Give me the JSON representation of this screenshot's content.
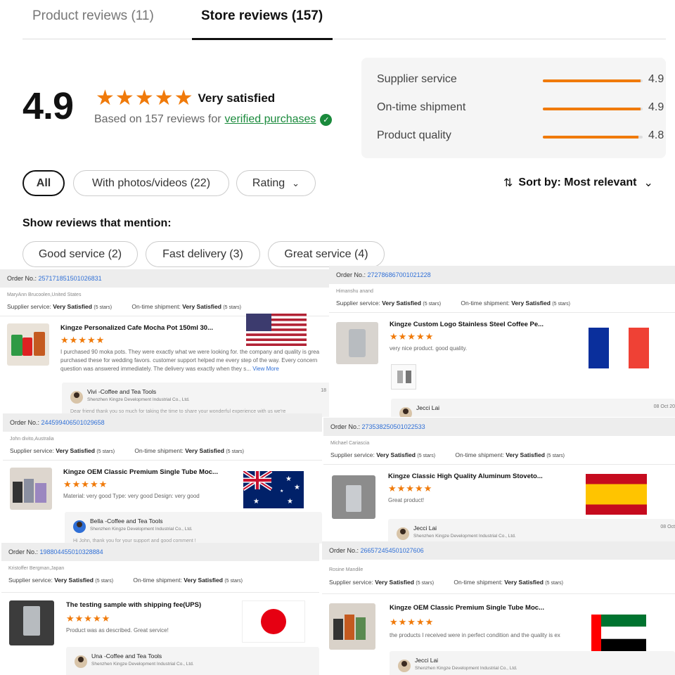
{
  "tabs": {
    "product": "Product reviews (11)",
    "store": "Store reviews (157)"
  },
  "summary": {
    "score": "4.9",
    "stars": "★★★★★",
    "label": "Very satisfied",
    "based_prefix": "Based on 157 reviews for",
    "verified_link": "verified purchases",
    "verified_icon": "check-badge-icon"
  },
  "ratings": [
    {
      "label": "Supplier service",
      "value": "4.9",
      "fill": 0.98
    },
    {
      "label": "On-time shipment",
      "value": "4.9",
      "fill": 0.98
    },
    {
      "label": "Product quality",
      "value": "4.8",
      "fill": 0.96
    }
  ],
  "filters": {
    "all": "All",
    "photos": "With photos/videos (22)",
    "rating": "Rating",
    "sort": "Sort by: Most relevant"
  },
  "mention": {
    "title": "Show reviews that mention:",
    "tags": [
      "Good service (2)",
      "Fast delivery (3)",
      "Great service (4)"
    ]
  },
  "order_prefix": "Order No.:",
  "supplier_service_label": "Supplier service:",
  "ontime_label": "On-time shipment:",
  "very_satisfied": "Very Satisfied",
  "five_stars": "(5 stars)",
  "mini_stars": "★★★★★",
  "company": "Shenzhen Kingze Development Industrial Co., Ltd.",
  "reviews": [
    {
      "order_no": "257171851501026831",
      "reviewer": "MaryAnn Brucoolen,United States",
      "title": "Kingze Personalized Cafe Mocha Pot 150ml 30...",
      "text1": "I purchased 90 moka pots. They were exactly what we were looking for. the company and quality is grea",
      "text2": "purchased these for wedding favors. customer support helped me every step of the way. Every concern",
      "text3": "question was answered immediately. The delivery was exactly when they s...",
      "view_more": "View More",
      "reply_name": "Vivi -Coffee and Tea Tools",
      "reply_date": "18",
      "reply_text": "Dear friend thank you so much for taking the time to share your wonderful experience with us we're",
      "flag": "usa"
    },
    {
      "order_no": "272786867001021228",
      "reviewer": "Himanshu anand",
      "title": "Kingze Custom Logo Stainless Steel Coffee Pe...",
      "text1": "very nice product. good quality.",
      "reply_name": "Jecci Lai",
      "reply_date": "08 Oct 20",
      "flag": "france"
    },
    {
      "order_no": "244599406501029658",
      "reviewer": "John divito,Australia",
      "title": "Kingze OEM Classic Premium Single Tube Moc...",
      "text1": "Material:  very good  Type:   very good Design:   very good",
      "reply_name": "Bella -Coffee and Tea Tools",
      "reply_text": "Hi John, thank you for your support and good comment !",
      "flag": "australia"
    },
    {
      "order_no": "273538250501022533",
      "reviewer": "Michael Cariascia",
      "title": "Kingze Classic High Quality Aluminum Stoveto...",
      "text1": "Great product!",
      "reply_name": "Jecci Lai",
      "reply_date": "08 Oct",
      "flag": "spain"
    },
    {
      "order_no": "198804455010328884",
      "reviewer": "Kristoffer Bergman,Japan",
      "title": "The testing sample with shipping fee(UPS)",
      "text1": "Product was as described. Great service!",
      "reply_name": "Una -Coffee and Tea Tools",
      "flag": "japan"
    },
    {
      "order_no": "266572454501027606",
      "reviewer": "Rosine Mandile",
      "title": "Kingze OEM Classic Premium Single Tube Moc...",
      "text1": "the products I received were in perfect condition and the quality is ex",
      "reply_name": "Jecci Lai",
      "flag": "uae"
    }
  ],
  "colors": {
    "accent": "#f07a0a",
    "link": "#2f6fd6",
    "verified": "#1a8a3c"
  }
}
